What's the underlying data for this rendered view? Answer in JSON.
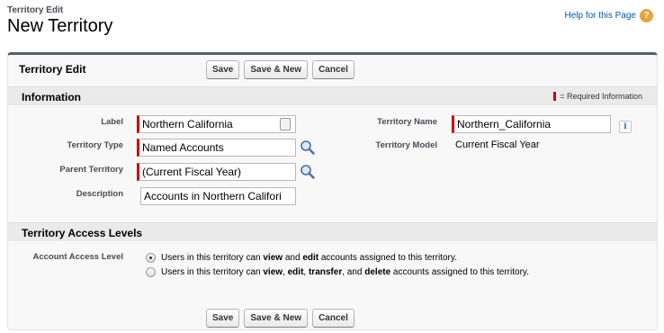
{
  "header": {
    "breadcrumb": "Territory Edit",
    "title": "New Territory",
    "help_link": "Help for this Page",
    "help_icon": "?"
  },
  "panel": {
    "title": "Territory Edit",
    "buttons": {
      "save": "Save",
      "save_new": "Save & New",
      "cancel": "Cancel"
    }
  },
  "information": {
    "title": "Information",
    "required_info": "= Required Information",
    "left": {
      "label_label": "Label",
      "label_value": "Northern California",
      "type_label": "Territory Type",
      "type_value": "Named Accounts",
      "parent_label": "Parent Territory",
      "parent_value": "(Current Fiscal Year)",
      "description_label": "Description",
      "description_value": "Accounts in Northern Califori"
    },
    "right": {
      "name_label": "Territory Name",
      "name_value": "Northern_California",
      "info_icon": "i",
      "model_label": "Territory Model",
      "model_value": "Current Fiscal Year"
    }
  },
  "access": {
    "title": "Territory Access Levels",
    "account_label": "Account Access Level",
    "option1": {
      "pre": "Users in this territory can ",
      "b1": "view",
      "mid1": " and ",
      "b2": "edit",
      "post": " accounts assigned to this territory."
    },
    "option2": {
      "pre": "Users in this territory can ",
      "b1": "view",
      "sep1": ", ",
      "b2": "edit",
      "sep2": ", ",
      "b3": "transfer",
      "sep3": ", and ",
      "b4": "delete",
      "post": " accounts assigned to this territory."
    },
    "selected": 1
  },
  "colors": {
    "required": "#cc0000",
    "link": "#015ba7",
    "help_icon": "#e8a33d"
  }
}
